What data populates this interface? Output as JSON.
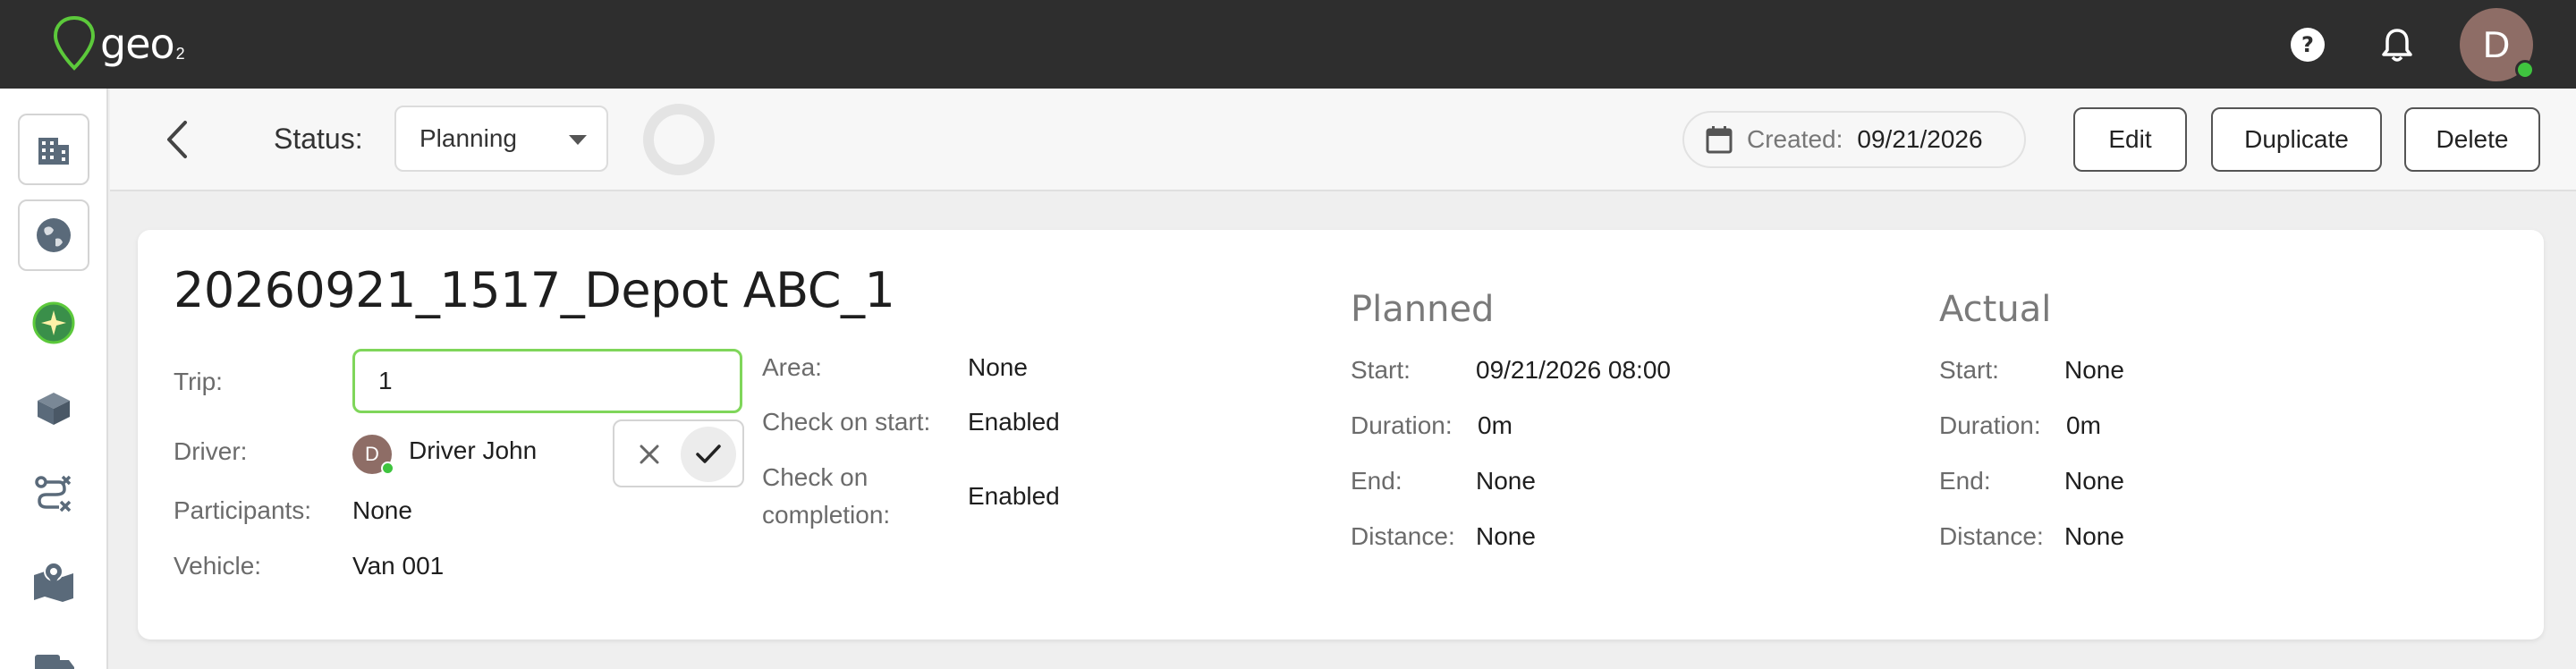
{
  "brand": {
    "name": "geo",
    "sub": "2",
    "accent": "#5cc93b"
  },
  "topbar": {
    "help_icon": "help-circle-icon",
    "bell_icon": "bell-icon",
    "avatar_initial": "D"
  },
  "sidebar": {
    "items": [
      {
        "icon": "building-icon"
      },
      {
        "icon": "globe-icon"
      },
      {
        "icon": "sparkle-globe-icon"
      },
      {
        "icon": "box-icon"
      },
      {
        "icon": "route-icon"
      },
      {
        "icon": "map-icon"
      },
      {
        "icon": "truck-icon"
      }
    ]
  },
  "header": {
    "status_label": "Status:",
    "status_value": "Planning",
    "created_label": "Created:",
    "created_value": "09/21/2026",
    "buttons": {
      "edit": "Edit",
      "duplicate": "Duplicate",
      "delete": "Delete"
    }
  },
  "trip": {
    "title": "20260921_1517_Depot ABC_1",
    "fields": {
      "trip_label": "Trip:",
      "trip_value": "1",
      "driver_label": "Driver:",
      "driver_initial": "D",
      "driver_value": "Driver John",
      "participants_label": "Participants:",
      "participants_value": "None",
      "vehicle_label": "Vehicle:",
      "vehicle_value": "Van 001",
      "area_label": "Area:",
      "area_value": "None",
      "check_start_label": "Check on start:",
      "check_start_value": "Enabled",
      "check_completion_label_1": "Check on",
      "check_completion_label_2": "completion:",
      "check_completion_value": "Enabled"
    },
    "planned": {
      "heading": "Planned",
      "start_label": "Start:",
      "start_value": "09/21/2026 08:00",
      "duration_label": "Duration:",
      "duration_value": "0m",
      "end_label": "End:",
      "end_value": "None",
      "distance_label": "Distance:",
      "distance_value": "None"
    },
    "actual": {
      "heading": "Actual",
      "start_label": "Start:",
      "start_value": "None",
      "duration_label": "Duration:",
      "duration_value": "0m",
      "end_label": "End:",
      "end_value": "None",
      "distance_label": "Distance:",
      "distance_value": "None"
    }
  }
}
